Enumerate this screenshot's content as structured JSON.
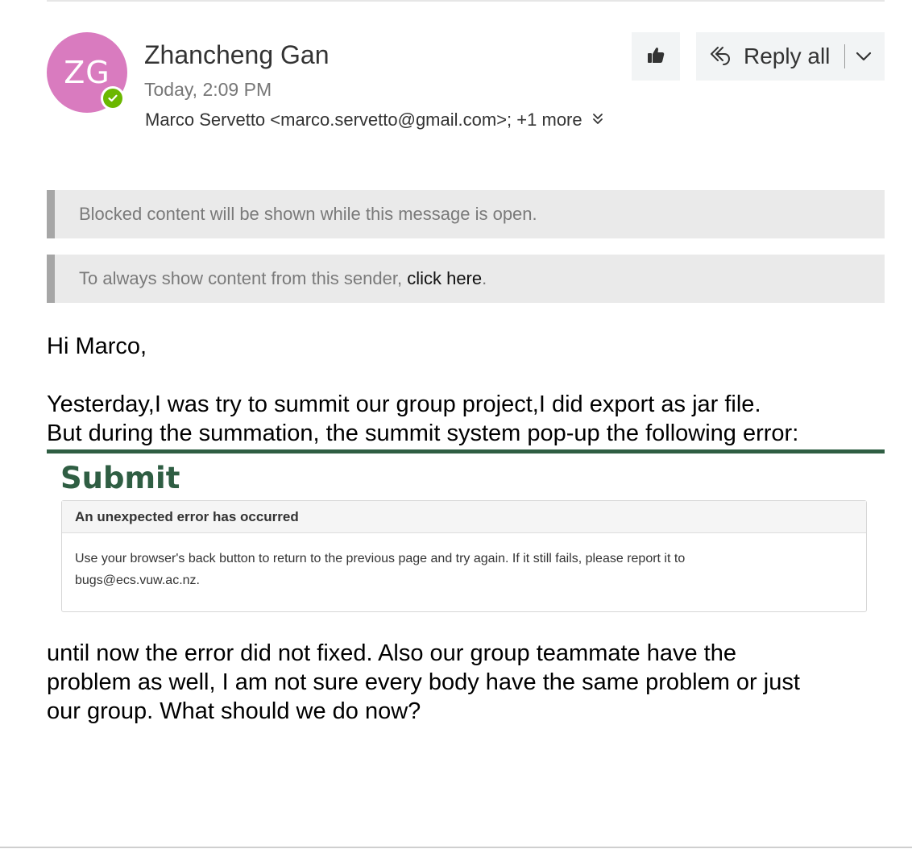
{
  "header": {
    "avatar_initials": "ZG",
    "avatar_color": "#d97bbf",
    "presence_color": "#6bb700",
    "sender_name": "Zhancheng Gan",
    "sent_time": "Today, 2:09 PM",
    "recipient": "Marco Servetto <marco.servetto@gmail.com>;",
    "more_recipients": "+1 more",
    "reply_all_label": "Reply all"
  },
  "infobars": {
    "blocked": "Blocked content will be shown while this message is open.",
    "always_show_prefix": "To always show content from this sender, ",
    "always_show_link": "click here",
    "always_show_suffix": "."
  },
  "message": {
    "greeting": "Hi Marco,",
    "para1_line1": "Yesterday,I was try to summit our group project,I did export as jar file.",
    "para1_line2": "But during the summation,  the summit system pop-up the following error:",
    "para2_line1": "until now the error did not fixed. Also our group teammate have the",
    "para2_line2": "problem as well, I am not sure every body have the same problem or just",
    "para2_line3": "our group. What should we do now?"
  },
  "embedded_screenshot": {
    "title": "Submit",
    "error_heading": "An unexpected error has occurred",
    "error_line1": "Use your browser's back button to return to the previous page and try again. If it still fails, please report it to",
    "error_line2": "bugs@ecs.vuw.ac.nz.",
    "accent_color": "#2f5e43"
  }
}
